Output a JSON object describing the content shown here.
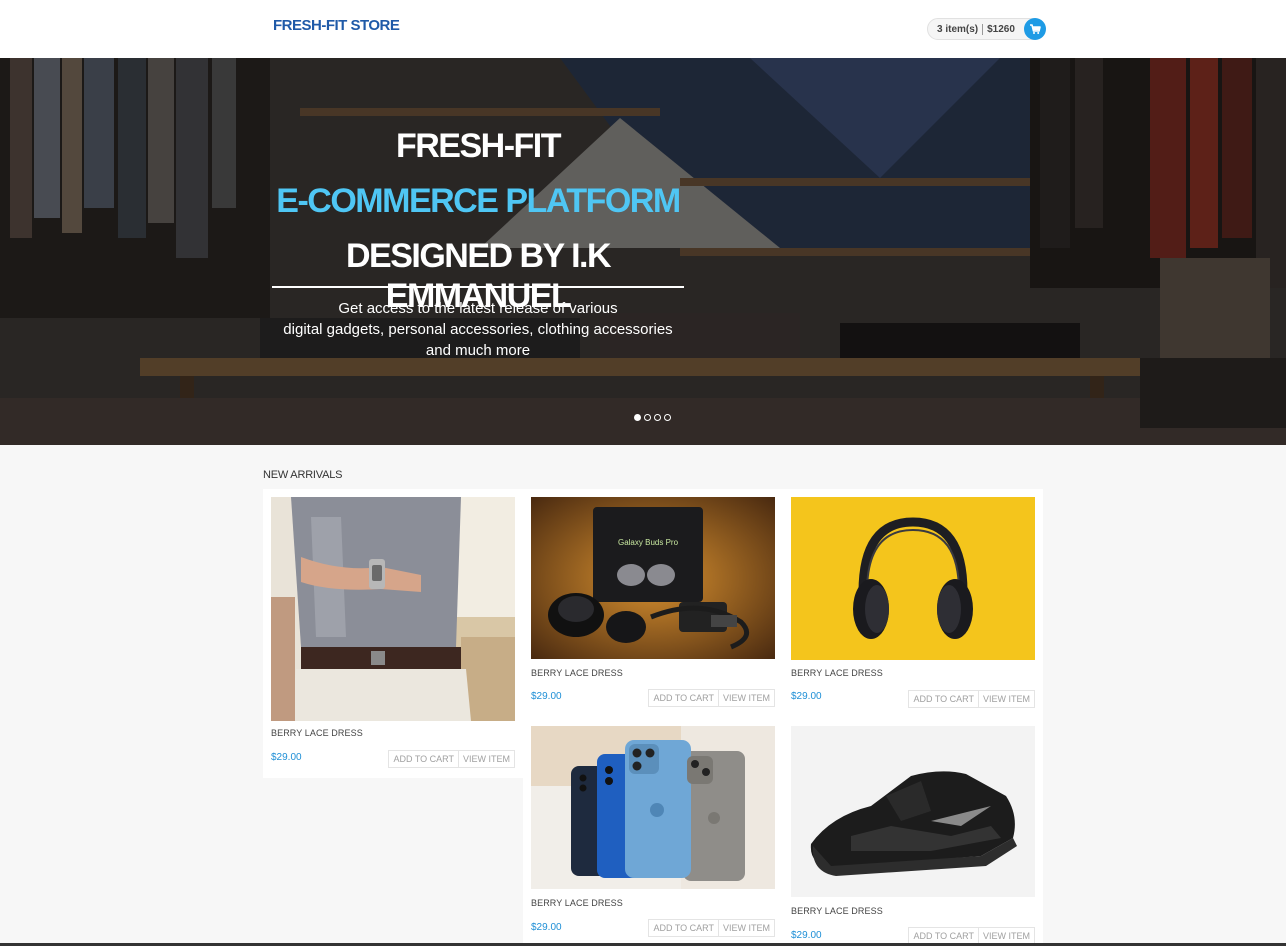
{
  "header": {
    "brand": "FRESH-FIT STORE",
    "cart_items": "3 item(s)",
    "cart_total": "$1260",
    "cart_icon": "cart-icon"
  },
  "hero": {
    "line1": "FRESH-FIT",
    "line2": "E-COMMERCE PLATFORM",
    "line3": "DESIGNED BY I.K EMMANUEL",
    "subtitle_1": "Get access to the latest release of various",
    "subtitle_2": "digital gadgets, personal accessories, clothing accessories",
    "subtitle_3": "and much more",
    "slides": 4,
    "active_slide": 1,
    "accent_color": "#4fc6f4"
  },
  "section": {
    "title": "NEW ARRIVALS"
  },
  "products": [
    {
      "name": "BERRY LACE DRESS",
      "price": "$29.00",
      "add": "ADD TO CART",
      "view": "VIEW ITEM",
      "image": "man-wristwatch"
    },
    {
      "name": "BERRY LACE DRESS",
      "price": "$29.00",
      "add": "ADD TO CART",
      "view": "VIEW ITEM",
      "image": "galaxy-buds-pro",
      "box_text": "Galaxy Buds Pro"
    },
    {
      "name": "BERRY LACE DRESS",
      "price": "$29.00",
      "add": "ADD TO CART",
      "view": "VIEW ITEM",
      "image": "headphones-yellow"
    },
    {
      "name": "BERRY LACE DRESS",
      "price": "$29.00",
      "add": "ADD TO CART",
      "view": "VIEW ITEM",
      "image": "iphones"
    },
    {
      "name": "BERRY LACE DRESS",
      "price": "$29.00",
      "add": "ADD TO CART",
      "view": "VIEW ITEM",
      "image": "black-sneaker"
    }
  ]
}
